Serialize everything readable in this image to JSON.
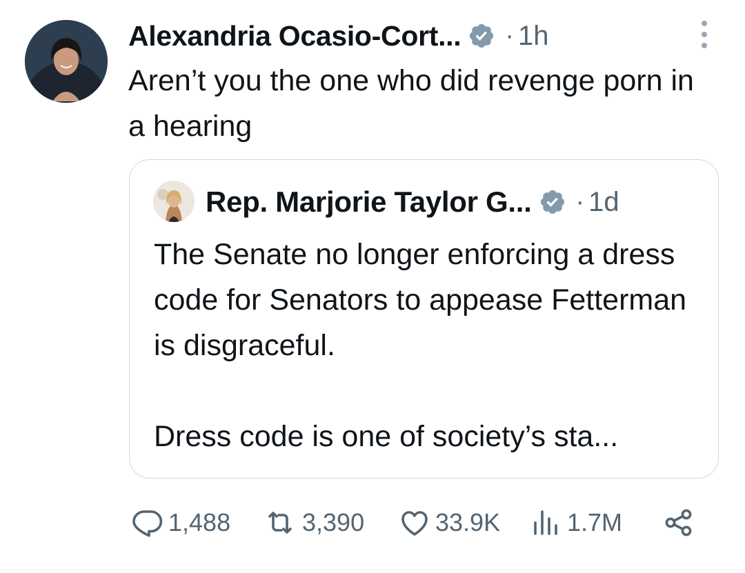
{
  "tweet": {
    "author_name": "Alexandria Ocasio-Cort...",
    "verified_icon": "verified-badge-icon",
    "dot": "·",
    "time": "1h",
    "text": "Aren’t you the one who did revenge porn in a hearing"
  },
  "quote": {
    "author_name": "Rep. Marjorie Taylor G...",
    "verified_icon": "verified-badge-icon",
    "dot": "·",
    "time": "1d",
    "text": "The Senate no longer enforcing a dress code for Senators to appease Fetterman is disgraceful.\n\nDress code is one of society’s sta..."
  },
  "actions": {
    "replies": "1,488",
    "reposts": "3,390",
    "likes": "33.9K",
    "views": "1.7M"
  },
  "colors": {
    "text": "#0f1419",
    "secondary": "#536471",
    "border": "#cfd9de",
    "verified_badge": "#829aab"
  }
}
